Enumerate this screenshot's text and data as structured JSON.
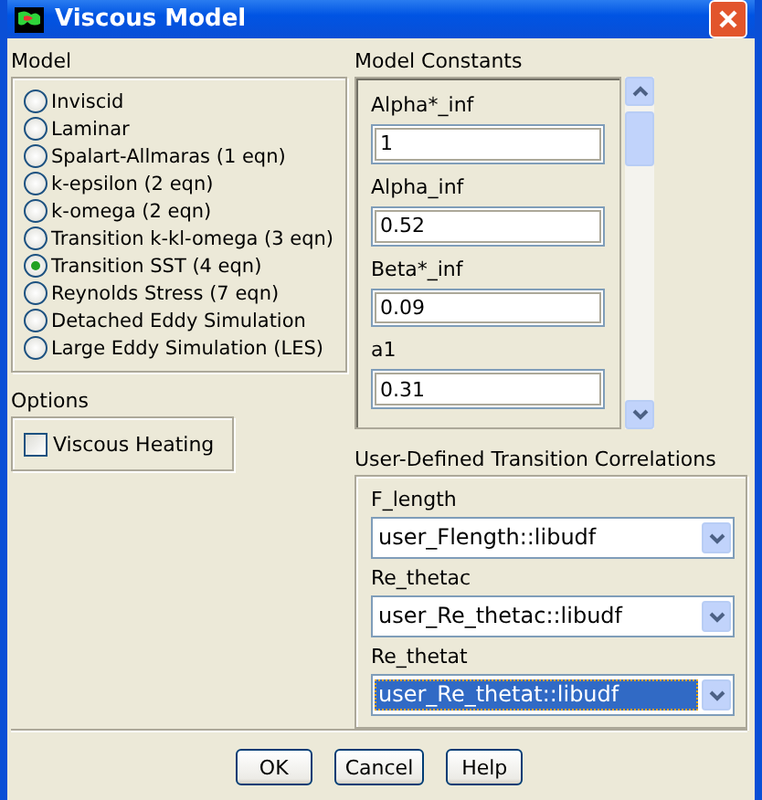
{
  "window": {
    "title": "Viscous Model"
  },
  "model": {
    "label": "Model",
    "options": [
      {
        "label": "Inviscid",
        "selected": false
      },
      {
        "label": "Laminar",
        "selected": false
      },
      {
        "label": "Spalart-Allmaras (1 eqn)",
        "selected": false
      },
      {
        "label": "k-epsilon (2 eqn)",
        "selected": false
      },
      {
        "label": "k-omega (2 eqn)",
        "selected": false
      },
      {
        "label": "Transition k-kl-omega (3 eqn)",
        "selected": false
      },
      {
        "label": "Transition SST (4 eqn)",
        "selected": true
      },
      {
        "label": "Reynolds Stress (7 eqn)",
        "selected": false
      },
      {
        "label": "Detached Eddy Simulation",
        "selected": false
      },
      {
        "label": "Large Eddy Simulation (LES)",
        "selected": false
      }
    ]
  },
  "options": {
    "label": "Options",
    "items": [
      {
        "label": "Viscous Heating",
        "checked": false
      }
    ]
  },
  "model_constants": {
    "label": "Model Constants",
    "fields": [
      {
        "label": "Alpha*_inf",
        "value": "1"
      },
      {
        "label": "Alpha_inf",
        "value": "0.52"
      },
      {
        "label": "Beta*_inf",
        "value": "0.09"
      },
      {
        "label": "a1",
        "value": "0.31"
      }
    ]
  },
  "correlations": {
    "label": "User-Defined Transition Correlations",
    "dropdowns": [
      {
        "label": "F_length",
        "value": "user_Flength::libudf",
        "selected": false
      },
      {
        "label": "Re_thetac",
        "value": "user_Re_thetac::libudf",
        "selected": false
      },
      {
        "label": "Re_thetat",
        "value": "user_Re_thetat::libudf",
        "selected": true
      }
    ]
  },
  "buttons": [
    "OK",
    "Cancel",
    "Help"
  ]
}
